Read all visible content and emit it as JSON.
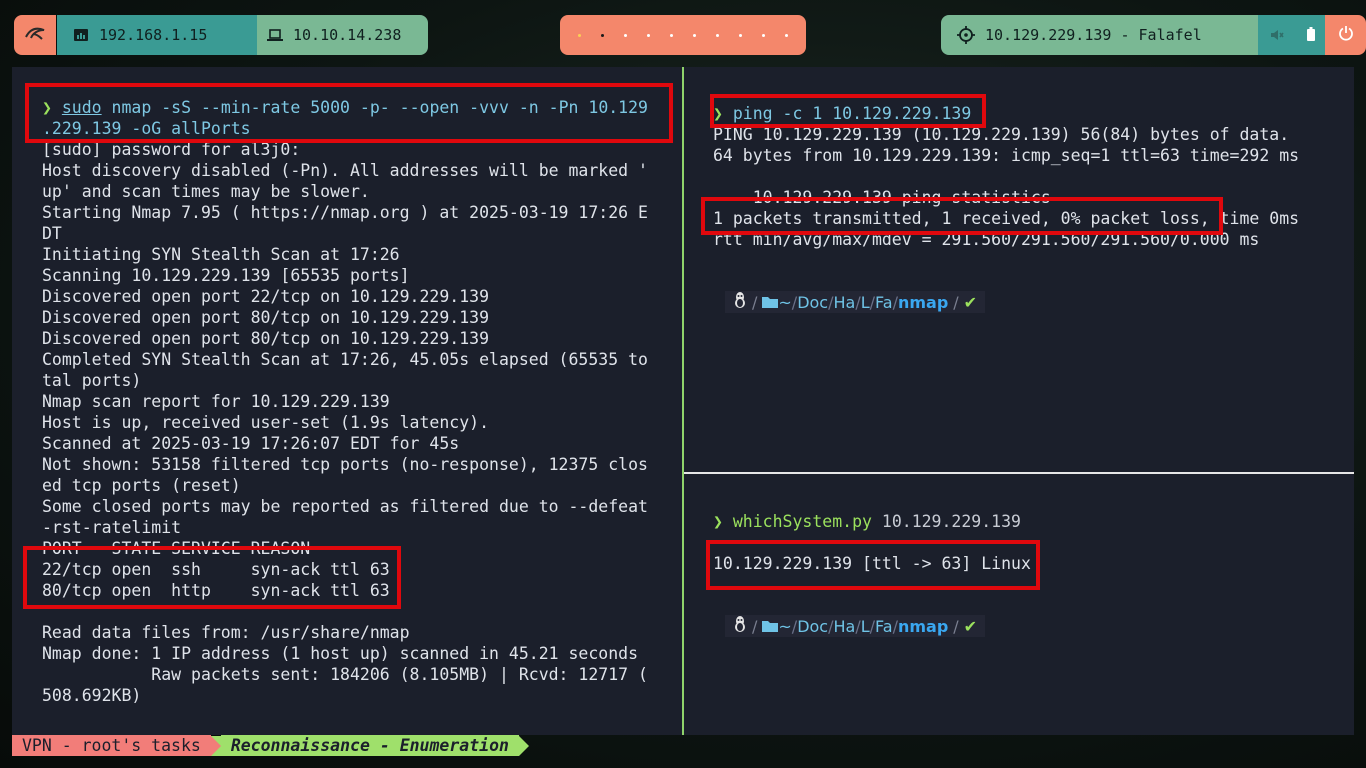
{
  "topbar": {
    "local_ip": "192.168.1.15",
    "vpn_ip": "10.10.14.238",
    "target": "10.129.229.139 - Falafel",
    "workspaces": [
      {
        "state": "active"
      },
      {
        "state": "current"
      },
      {
        "state": "empty"
      },
      {
        "state": "empty"
      },
      {
        "state": "empty"
      },
      {
        "state": "empty"
      },
      {
        "state": "empty"
      },
      {
        "state": "empty"
      },
      {
        "state": "empty"
      },
      {
        "state": "empty"
      }
    ]
  },
  "left_pane": {
    "prompt_symbol": "❯",
    "command": {
      "sudo": "sudo",
      "rest": " nmap -sS --min-rate 5000 -p- --open -vvv -n -Pn 10.129",
      "cont": ".229.139 -oG allPorts"
    },
    "output": [
      "[sudo] password for al3j0:",
      "Host discovery disabled (-Pn). All addresses will be marked '",
      "up' and scan times may be slower.",
      "Starting Nmap 7.95 ( https://nmap.org ) at 2025-03-19 17:26 E",
      "DT",
      "Initiating SYN Stealth Scan at 17:26",
      "Scanning 10.129.229.139 [65535 ports]",
      "Discovered open port 22/tcp on 10.129.229.139",
      "Discovered open port 80/tcp on 10.129.229.139",
      "Discovered open port 80/tcp on 10.129.229.139",
      "Completed SYN Stealth Scan at 17:26, 45.05s elapsed (65535 to",
      "tal ports)",
      "Nmap scan report for 10.129.229.139",
      "Host is up, received user-set (1.9s latency).",
      "Scanned at 2025-03-19 17:26:07 EDT for 45s",
      "Not shown: 53158 filtered tcp ports (no-response), 12375 clos",
      "ed tcp ports (reset)",
      "Some closed ports may be reported as filtered due to --defeat",
      "-rst-ratelimit",
      "PORT   STATE SERVICE REASON",
      "22/tcp open  ssh     syn-ack ttl 63",
      "80/tcp open  http    syn-ack ttl 63",
      "",
      "Read data files from: /usr/share/nmap",
      "Nmap done: 1 IP address (1 host up) scanned in 45.21 seconds",
      "           Raw packets sent: 184206 (8.105MB) | Rcvd: 12717 (",
      "508.692KB)"
    ]
  },
  "right_top": {
    "prompt_symbol": "❯",
    "command": "ping",
    "args": " -c 1 10.129.229.139",
    "output": [
      "PING 10.129.229.139 (10.129.229.139) 56(84) bytes of data.",
      "64 bytes from 10.129.229.139: icmp_seq=1 ttl=63 time=292 ms",
      "",
      "--- 10.129.229.139 ping statistics ---",
      "1 packets transmitted, 1 received, 0% packet loss, time 0ms",
      "rtt min/avg/max/mdev = 291.560/291.560/291.560/0.000 ms"
    ]
  },
  "right_bottom": {
    "prompt_symbol": "❯",
    "command": "whichSystem.py",
    "args": " 10.129.229.139",
    "output": "10.129.229.139 [ttl -> 63] Linux"
  },
  "path_prompt": {
    "tilde": "~",
    "parts": [
      "Doc",
      "Ha",
      "L",
      "Fa"
    ],
    "cwd": "nmap",
    "ok": "✔"
  },
  "statusbar": {
    "session": "VPN - root's tasks",
    "task": "Reconnaissance - Enumeration"
  }
}
